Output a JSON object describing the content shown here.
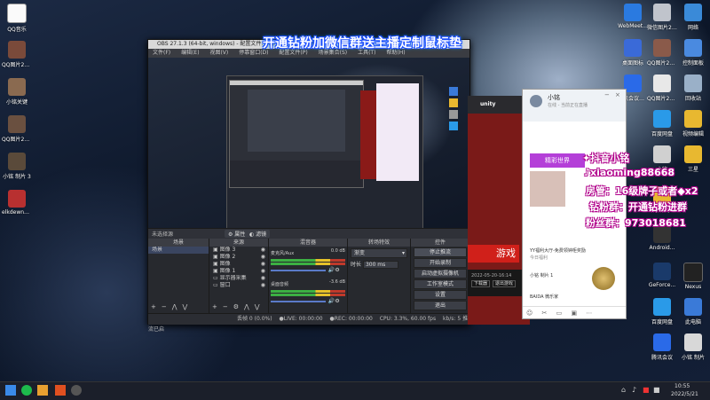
{
  "banner": "开通钻粉加微信群送主播定制鼠标垫",
  "desktop_left": [
    {
      "label": "QQ音乐"
    },
    {
      "label": "QQ图片20220506..."
    },
    {
      "label": "小铭关键"
    },
    {
      "label": "QQ图片20220518..."
    },
    {
      "label": "小铭 制片 3"
    },
    {
      "label": "elkdewn82..."
    }
  ],
  "desktop_right": [
    {
      "label": "WebMeet..."
    },
    {
      "label": "微信图片20220509..."
    },
    {
      "label": "网络"
    },
    {
      "label": "桌面图标"
    },
    {
      "label": "QQ图片20211204..."
    },
    {
      "label": "控制面板"
    },
    {
      "label": "腾讯会议Beta"
    },
    {
      "label": "QQ图片202205..."
    },
    {
      "label": "回收站"
    },
    {
      "label": "百度网盘"
    },
    {
      "label": "视频编辑"
    },
    {
      "label": "小铭"
    },
    {
      "label": "三星"
    },
    {
      "label": "小铭的"
    },
    {
      "label": "Android..."
    },
    {
      "label": "GeForce..."
    },
    {
      "label": "Nexus"
    },
    {
      "label": "百度网盘"
    },
    {
      "label": "此电脑"
    },
    {
      "label": "腾讯会议"
    },
    {
      "label": "小铭 制片"
    }
  ],
  "obs": {
    "title": "OBS 27.1.3 (64-bit, windows) - 配置文件: 未命名 - 场景: 未命名",
    "menu": [
      "文件(F)",
      "编辑(E)",
      "视图(V)",
      "停靠窗口(D)",
      "配置文件(P)",
      "场景集合(S)",
      "工具(T)",
      "帮助(H)"
    ],
    "no_source": "未选择源",
    "props_btn": "属性",
    "filters_btn": "滤镜",
    "docks": {
      "scenes": "场景",
      "sources": "来源",
      "mixer": "混音器",
      "transitions": "转场特效",
      "controls": "控件"
    },
    "scenes": [
      "场景"
    ],
    "sources": [
      "图像 3",
      "图像 2",
      "图像",
      "图像 1",
      "显示器采集",
      "窗口"
    ],
    "mixer": [
      {
        "name": "麦克风/Aux",
        "level": "0.0 dB"
      },
      {
        "name": "桌面音频",
        "level": "-3.6 dB"
      }
    ],
    "transition": "渐变",
    "duration_label": "时长",
    "duration_value": "300 ms",
    "controls": [
      "停止推流",
      "开始录制",
      "启动虚拟摄像机",
      "工作室模式",
      "设置",
      "退出"
    ],
    "status": {
      "drop": "丢帧 0 (0.0%)",
      "live": "LIVE: 00:00:00",
      "rec": "REC: 00:00:00",
      "cpu": "CPU: 3.3%, 60.00 fps",
      "kbps": "kb/s: 5 推流已启"
    }
  },
  "game": {
    "brand": "unity",
    "button": "游戏",
    "date": "2022-05-20-16:14",
    "link1": "下载器",
    "link2": "退出游戏"
  },
  "chat": {
    "name": "小铭",
    "status": "在线 - 当前正在直播",
    "banner": "精彩世界",
    "message": "YY福利大厅-免费领钟柜奖励",
    "sub1": "今日福利",
    "sub2": "小铭 制片 1",
    "sub3": "BAIDA 微乐家"
  },
  "overlay": {
    "line1": "抖音小铭",
    "line2": "xiaoming88668",
    "line3": "房管：16级牌子或者",
    "line3_badge": "x2",
    "line4": "钻粉群：开通钻粉进群",
    "line5": "粉丝群：973018681"
  },
  "taskbar": {
    "time": "10:55",
    "date": "2022/5/21"
  }
}
